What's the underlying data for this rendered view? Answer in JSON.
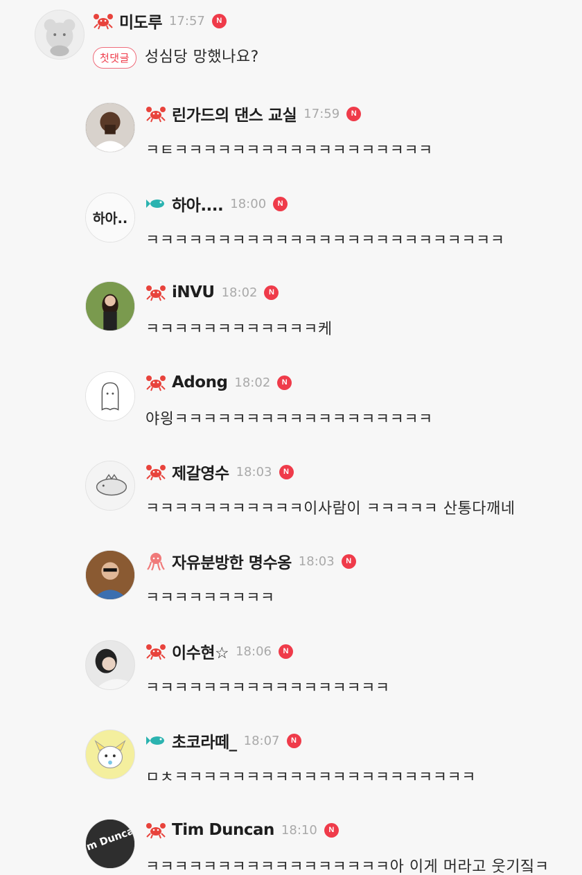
{
  "comments": [
    {
      "nickname": "미도루",
      "time": "17:57",
      "badge": "N",
      "first_tag": "첫댓글",
      "text": "성심당 망했나요?",
      "level_icon": "crab-icon",
      "avatar": "bear-avatar"
    },
    {
      "nickname": "린가드의 댄스 교실",
      "time": "17:59",
      "badge": "N",
      "text": "ㅋㅌㅋㅋㅋㅋㅋㅋㅋㅋㅋㅋㅋㅋㅋㅋㅋㅋㅋㅋ",
      "level_icon": "crab-icon",
      "avatar": "photo-avatar"
    },
    {
      "nickname": "하아....",
      "time": "18:00",
      "badge": "N",
      "text": "ㅋㅋㅋㅋㅋㅋㅋㅋㅋㅋㅋㅋㅋㅋㅋㅋㅋㅋㅋㅋㅋㅋㅋㅋㅋ",
      "level_icon": "fish-icon",
      "avatar": "text-logo-avatar"
    },
    {
      "nickname": "iNVU",
      "time": "18:02",
      "badge": "N",
      "text": "ㅋㅋㅋㅋㅋㅋㅋㅋㅋㅋㅋㅋ케",
      "level_icon": "crab-icon",
      "avatar": "photo-avatar"
    },
    {
      "nickname": "Adong",
      "time": "18:02",
      "badge": "N",
      "text": "야읭ㅋㅋㅋㅋㅋㅋㅋㅋㅋㅋㅋㅋㅋㅋㅋㅋㅋㅋ",
      "level_icon": "crab-icon",
      "avatar": "ghost-avatar"
    },
    {
      "nickname": "제갈영수",
      "time": "18:03",
      "badge": "N",
      "text": "ㅋㅋㅋㅋㅋㅋㅋㅋㅋㅋㅋ이사람이 ㅋㅋㅋㅋㅋ 산통다깨네",
      "level_icon": "crab-icon",
      "avatar": "dino-avatar"
    },
    {
      "nickname": "자유분방한 명수옹",
      "time": "18:03",
      "badge": "N",
      "text": "ㅋㅋㅋㅋㅋㅋㅋㅋㅋ",
      "level_icon": "octopus-icon",
      "avatar": "photo-avatar"
    },
    {
      "nickname": "이수현☆",
      "time": "18:06",
      "badge": "N",
      "text": "ㅋㅋㅋㅋㅋㅋㅋㅋㅋㅋㅋㅋㅋㅋㅋㅋㅋ",
      "level_icon": "crab-icon",
      "avatar": "photo-avatar"
    },
    {
      "nickname": "초코라떼_",
      "time": "18:07",
      "badge": "N",
      "text": "ㅁㅊㅋㅋㅋㅋㅋㅋㅋㅋㅋㅋㅋㅋㅋㅋㅋㅋㅋㅋㅋㅋㅋ",
      "level_icon": "fish-icon",
      "avatar": "cartoon-avatar"
    },
    {
      "nickname": "Tim Duncan",
      "time": "18:10",
      "badge": "N",
      "text": "ㅋㅋㅋㅋㅋㅋㅋㅋㅋㅋㅋㅋㅋㅋㅋㅋㅋ아 이게 머라고 웃기짘ㅋ",
      "level_icon": "crab-icon",
      "avatar": "logo-avatar",
      "avatar_text": "Tim Duncan"
    }
  ],
  "colors": {
    "badge": "#ef3b4a",
    "crab": "#e8433c",
    "fish": "#2bb3b0",
    "octopus": "#f07a7a",
    "time": "#a9a9a9"
  }
}
